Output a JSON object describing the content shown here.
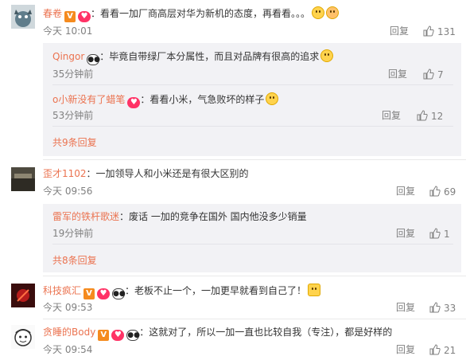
{
  "reply_label": "回复",
  "comments": [
    {
      "user": "春卷",
      "text": "：看看一加厂商高层对华为新机的态度，再看看。。。",
      "time": "今天 10:01",
      "likes": "131",
      "replies": [
        {
          "user": "Qingor",
          "text": "：毕竟自带绿厂本分属性，而且对品牌有很高的追求",
          "time": "35分钟前",
          "likes": "7"
        },
        {
          "user": "o小新没有了蜡笔",
          "text": "：看看小米，气急败坏的样子",
          "time": "53分钟前",
          "likes": "12"
        }
      ],
      "more": "共9条回复"
    },
    {
      "user": "歪才1102",
      "text": "：一加领导人和小米还是有很大区别的",
      "time": "今天 09:56",
      "likes": "69",
      "replies": [
        {
          "user": "雷军的铁杆歌迷",
          "text": "：废话 一加的竞争在国外 国内他没多少销量",
          "time": "19分钟前",
          "likes": "1"
        }
      ],
      "more": "共8条回复"
    },
    {
      "user": "科技疯汇",
      "text": "：老板不止一个，一加更早就看到自己了！",
      "time": "今天 09:53",
      "likes": "33"
    },
    {
      "user": "贪睡的Body",
      "text": "：这就对了，所以一加一直也比较自我（专注），都是好样的",
      "time": "今天 09:54",
      "likes": "21"
    }
  ]
}
